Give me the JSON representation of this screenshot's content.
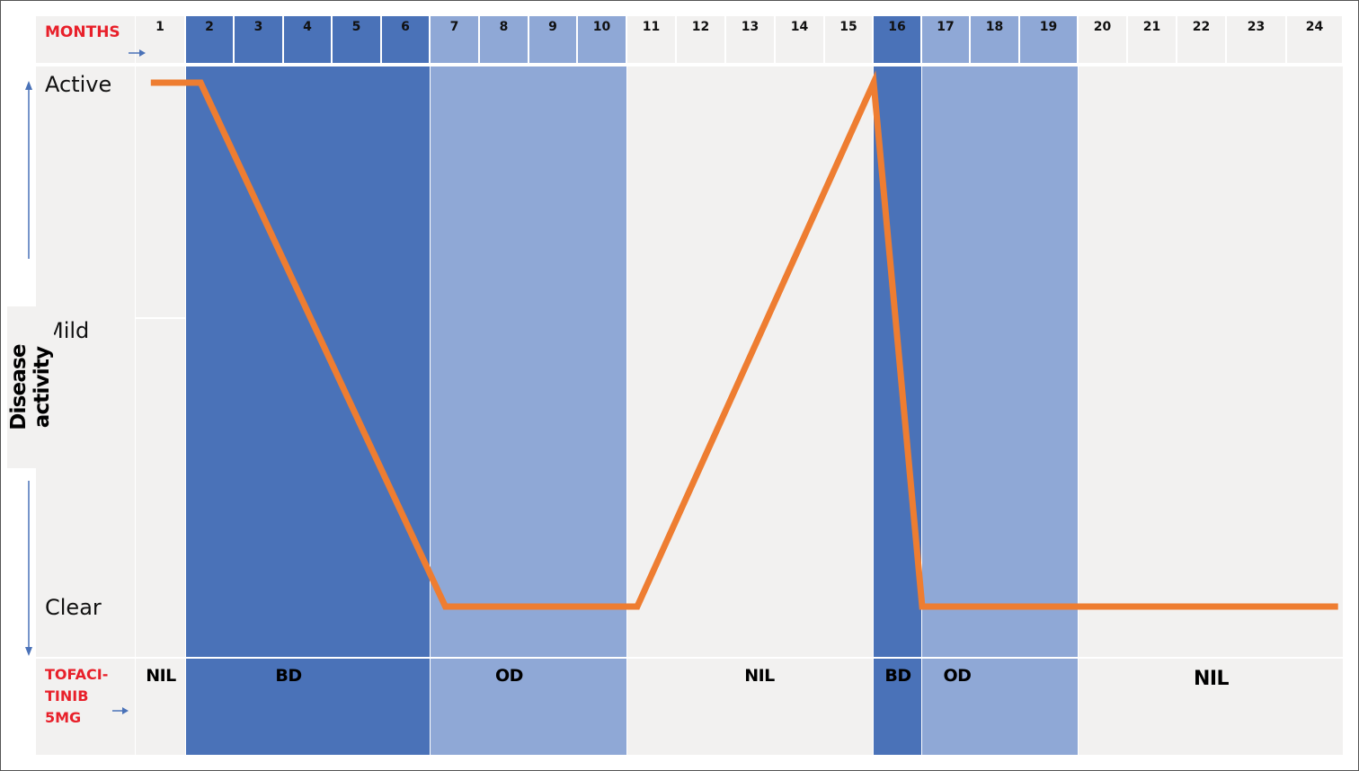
{
  "colors": {
    "bd": "#4a72b8",
    "od": "#8fa8d6",
    "nil": "#f2f1f0",
    "label_bg": "#f2f1f0",
    "line": "#ee7d31",
    "red_text": "#e8202a",
    "arrow": "#4a72b8"
  },
  "header": {
    "months_label": "MONTHS",
    "months": [
      "1",
      "2",
      "3",
      "4",
      "5",
      "6",
      "7",
      "8",
      "9",
      "10",
      "11",
      "12",
      "13",
      "14",
      "15",
      "16",
      "17",
      "18",
      "19",
      "20",
      "21",
      "22",
      "23",
      "24"
    ]
  },
  "y_axis": {
    "title": "Disease activity",
    "levels": [
      "Active",
      "Mild",
      "Clear"
    ]
  },
  "treatment_row": {
    "label_lines": [
      "TOFACI-",
      "TINIB",
      "5MG"
    ],
    "segments": [
      {
        "label": "NIL",
        "start_month": 1,
        "end_month": 1,
        "type": "nil"
      },
      {
        "label": "BD",
        "start_month": 2,
        "end_month": 6,
        "type": "bd"
      },
      {
        "label": "OD",
        "start_month": 7,
        "end_month": 10,
        "type": "od"
      },
      {
        "label": "NIL",
        "start_month": 11,
        "end_month": 15,
        "type": "nil"
      },
      {
        "label": "BD",
        "start_month": 16,
        "end_month": 16,
        "type": "bd"
      },
      {
        "label": "OD",
        "start_month": 17,
        "end_month": 19,
        "type": "od"
      },
      {
        "label": "NIL",
        "start_month": 20,
        "end_month": 24,
        "type": "nil"
      }
    ]
  },
  "chart_data": {
    "type": "line",
    "title": "",
    "xlabel": "MONTHS",
    "ylabel": "Disease activity",
    "x_categories": [
      "1",
      "2",
      "3",
      "4",
      "5",
      "6",
      "7",
      "8",
      "9",
      "10",
      "11",
      "12",
      "13",
      "14",
      "15",
      "16",
      "17",
      "18",
      "19",
      "20",
      "21",
      "22",
      "23",
      "24"
    ],
    "y_categories": [
      "Clear",
      "Mild",
      "Active"
    ],
    "y_range": [
      0,
      2
    ],
    "series": [
      {
        "name": "Disease activity",
        "points": [
          {
            "month": 1.3,
            "level": 2
          },
          {
            "month": 2.3,
            "level": 2
          },
          {
            "month": 7.3,
            "level": 0
          },
          {
            "month": 11.2,
            "level": 0
          },
          {
            "month": 16.0,
            "level": 2
          },
          {
            "month": 17.0,
            "level": 0
          },
          {
            "month": 24.9,
            "level": 0
          }
        ]
      }
    ],
    "bands": [
      {
        "label": "NIL",
        "start_month": 1,
        "end_month": 1,
        "type": "nil"
      },
      {
        "label": "BD",
        "start_month": 2,
        "end_month": 6,
        "type": "bd"
      },
      {
        "label": "OD",
        "start_month": 7,
        "end_month": 10,
        "type": "od"
      },
      {
        "label": "NIL",
        "start_month": 11,
        "end_month": 15,
        "type": "nil"
      },
      {
        "label": "BD",
        "start_month": 16,
        "end_month": 16,
        "type": "bd"
      },
      {
        "label": "OD",
        "start_month": 17,
        "end_month": 19,
        "type": "od"
      },
      {
        "label": "NIL",
        "start_month": 20,
        "end_month": 24,
        "type": "nil"
      }
    ],
    "legend": "none",
    "grid": false
  }
}
